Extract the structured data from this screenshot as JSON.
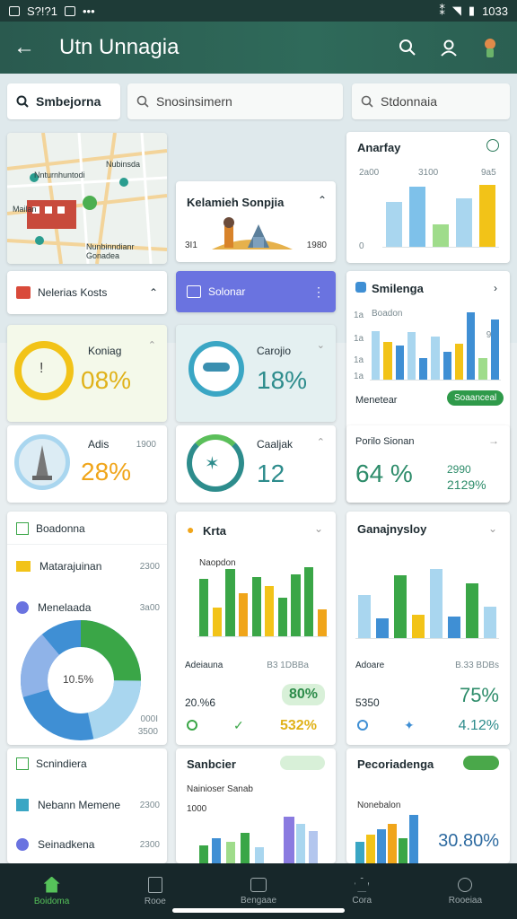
{
  "status": {
    "time": "1033",
    "left_text": "S?!?1"
  },
  "appbar": {
    "title": "Utn Unnagia"
  },
  "search": {
    "tab1": "Smbejorna",
    "tab2": "Snosinsimern",
    "tab3": "Stdonnaia"
  },
  "map": {
    "label1": "Nnturnhuntodi",
    "label2": "Nubinsda",
    "label3": "Mailan",
    "label4": "Nunbinndianr Gonadea"
  },
  "place_card": {
    "title": "Kelamieh Sonpjia",
    "left": "3I1",
    "right": "1980"
  },
  "anarfay": {
    "title": "Anarfay",
    "t1": "2a00",
    "t2": "3100",
    "t3": "9a5",
    "zero": "0"
  },
  "nav_card": {
    "label": "Nelerias Kosts"
  },
  "purple_card": {
    "label": "Solonar"
  },
  "smilenga": {
    "title": "Smilenga",
    "sub": "Boadon",
    "tick1": "1a",
    "tick2": "1a",
    "tick3": "1a",
    "tick4": "1a",
    "right_tick": "9E",
    "footer_label": "Menetear",
    "footer_btn": "Soaanceal"
  },
  "stat1": {
    "title": "Koniag",
    "value": "08%"
  },
  "stat2": {
    "title": "Carojio",
    "value": "18%"
  },
  "stat3": {
    "title": "Adis",
    "sub": "1900",
    "value": "28%"
  },
  "stat4": {
    "title": "Caaljak",
    "value": "12"
  },
  "porlo": {
    "title": "Porilo Sionan",
    "value": "64 %",
    "right1": "2990",
    "right2": "2129%"
  },
  "list": {
    "header": "Boadonna",
    "row1": "Matarajuinan",
    "row1_val": "2300",
    "row2": "Menelaada",
    "row2_val": "3a00",
    "donut_center": "10.5%",
    "donut_label1": "000I",
    "donut_label2": "3500"
  },
  "krta": {
    "title": "Krta",
    "sub": "Naopdon",
    "footer1": "Adeiauna",
    "footer1_right": "B3 1DBBa",
    "footer2": "20.%6",
    "badge": "80%",
    "pct": "532%"
  },
  "ganaj": {
    "title": "Ganajnysloy",
    "footer1": "Adoare",
    "footer1_right": "B.33 BDBs",
    "footer2": "5350",
    "value": "75%",
    "pct": "4.12%"
  },
  "list2": {
    "header": "Scnindiera",
    "row1": "Nebann Memene",
    "row1_val": "2300",
    "row2": "Seinadkena",
    "row2_val": "2300"
  },
  "sanbc": {
    "title": "Sanbcier",
    "sub": "Nainioser Sanab",
    "left": "1000"
  },
  "porca": {
    "title": "Pecoriadenga",
    "sub": "Nonebalon",
    "value": "30.80%"
  },
  "bottomnav": {
    "items": [
      "Boidoma",
      "Rooe",
      "Bengaae",
      "Cora",
      "Rooeiaa"
    ]
  },
  "colors": {
    "green": "#3aa647",
    "blue": "#3f8fd4",
    "yellow": "#f2c318",
    "teal": "#2d8c8c",
    "lightblue": "#a9d6ef",
    "lightgreen": "#9fdc8b",
    "orange": "#f0a51a"
  },
  "chart_data": [
    {
      "type": "bar",
      "title": "Anarfay",
      "values": [
        52,
        70,
        26,
        56,
        72
      ]
    },
    {
      "type": "bar",
      "title": "Smilenga",
      "values": [
        56,
        44,
        40,
        55,
        25,
        50,
        32,
        42,
        78,
        25,
        70
      ]
    },
    {
      "type": "bar",
      "title": "Krta",
      "values": [
        60,
        30,
        70,
        45,
        62,
        52,
        40,
        65,
        72,
        28
      ]
    },
    {
      "type": "bar",
      "title": "Ganajnysloy",
      "values": [
        55,
        25,
        80,
        30,
        88,
        28,
        70,
        40
      ]
    }
  ]
}
